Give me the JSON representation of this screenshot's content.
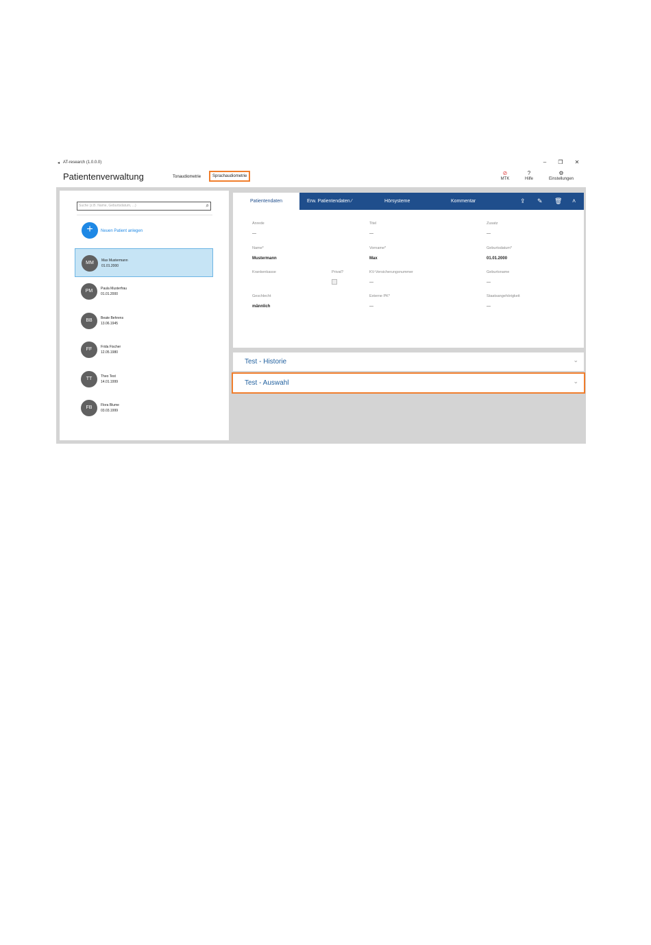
{
  "window": {
    "title": "AT-research (1.0.0.0)",
    "minimize": "–",
    "restore": "❐",
    "close": "✕"
  },
  "header": {
    "page_title": "Patientenverwaltung",
    "nav": [
      {
        "label": "Tonaudiometrie",
        "active": false
      },
      {
        "label": "Sprachaudiometrie",
        "active": true
      }
    ],
    "buttons": [
      {
        "label": "MTK",
        "icon": "⊘",
        "color": "#e04040"
      },
      {
        "label": "Hilfe",
        "icon": "?"
      },
      {
        "label": "Einstellungen",
        "icon": "⚙"
      }
    ]
  },
  "sidebar": {
    "search_placeholder": "Suche (z.B. Name, Geburtsdatum, ...)",
    "add_label": "Neuen Patient anlegen",
    "patients": [
      {
        "initials": "MM",
        "name": "Max Mustermann",
        "dob": "01.01.2000",
        "selected": true
      },
      {
        "initials": "PM",
        "name": "Paula Musterfrau",
        "dob": "01.01.2000",
        "selected": false
      },
      {
        "initials": "BB",
        "name": "Beate Behrens",
        "dob": "13.06.1945",
        "selected": false
      },
      {
        "initials": "FF",
        "name": "Frida Fischer",
        "dob": "12.05.1980",
        "selected": false
      },
      {
        "initials": "TT",
        "name": "Theo Test",
        "dob": "14.01.1999",
        "selected": false
      },
      {
        "initials": "FB",
        "name": "Flora Blume",
        "dob": "03.03.1999",
        "selected": false
      }
    ]
  },
  "card": {
    "tabs": [
      {
        "label": "Patientendaten",
        "active": true
      },
      {
        "label": "Erw. Patientendaten ⁄",
        "active": false
      },
      {
        "label": "Hörsysteme",
        "active": false
      },
      {
        "label": "Kommentar",
        "active": false
      }
    ],
    "fields": {
      "anrede": {
        "label": "Anrede",
        "value": "---"
      },
      "titel": {
        "label": "Titel",
        "value": "---"
      },
      "zusatz": {
        "label": "Zusatz",
        "value": "---"
      },
      "name": {
        "label": "Name*",
        "value": "Mustermann"
      },
      "vorname": {
        "label": "Vorname*",
        "value": "Max"
      },
      "geburtsdatum": {
        "label": "Geburtsdatum*",
        "value": "01.01.2000"
      },
      "krankenkasse": {
        "label": "Krankenkasse",
        "value": ""
      },
      "privat": {
        "label": "Privat?",
        "value": ""
      },
      "kv": {
        "label": "KV-Versicherungsnummer",
        "value": "---"
      },
      "geburtsname": {
        "label": "Geburtsname",
        "value": "---"
      },
      "geschlecht": {
        "label": "Geschlecht",
        "value": "männlich"
      },
      "externe_pk": {
        "label": "Externe PK*",
        "value": "---"
      },
      "staatsangehoerigkeit": {
        "label": "Staatsangehörigkeit",
        "value": "---"
      }
    }
  },
  "accordions": [
    {
      "title": "Test - Historie"
    },
    {
      "title": "Test - Auswahl"
    }
  ],
  "colors": {
    "accent": "#1f4e8c",
    "highlight": "#f07d2b",
    "add_button": "#1e88e5",
    "selected_row": "#c6e4f5"
  }
}
